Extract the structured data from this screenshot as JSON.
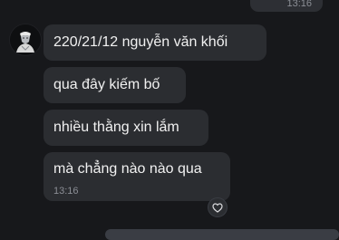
{
  "previous_message": {
    "time": "13:16"
  },
  "messages": [
    {
      "text": "220/21/12 nguyễn văn khối"
    },
    {
      "text": "qua đây kiếm bố"
    },
    {
      "text": "nhiều thằng xin lắm"
    },
    {
      "text": "mà chẳng nào nào qua",
      "time": "13:16"
    }
  ],
  "reaction": {
    "icon": "heart-outline-icon"
  },
  "colors": {
    "background": "#17181b",
    "bubble": "#2b2d31",
    "text": "#f1f1f1",
    "timestamp": "#8b8e95"
  }
}
